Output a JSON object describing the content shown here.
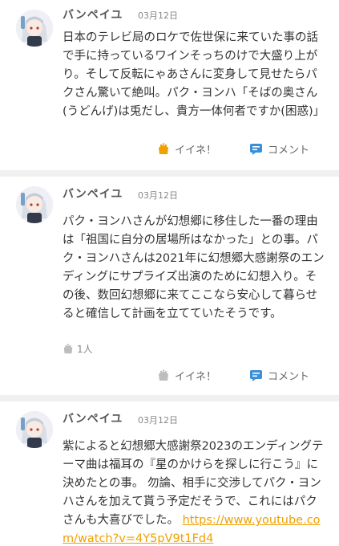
{
  "posts": [
    {
      "user": "バンペイユ",
      "date": "03月12日",
      "text": "日本のテレビ局のロケで佐世保に来ていた事の話で手に持っているワインそっちのけで大盛り上がり。そして反転にゃあさんに変身して見せたらパクさん驚いて絶叫。パク・ヨンハ「そばの奥さん(うどんげ)は兎だし、貴方一体何者ですか(困惑)」",
      "like_label": "イイネ！",
      "comment_label": "コメント",
      "liked": true
    },
    {
      "user": "バンペイユ",
      "date": "03月12日",
      "text": "パク・ヨンハさんが幻想郷に移住した一番の理由は「祖国に自分の居場所はなかった」との事。パク・ヨンハさんは2021年に幻想郷大感謝祭のエンディングにサプライズ出演のために幻想入り。その後、数回幻想郷に来てここなら安心して暮らせると確信して計画を立てていたそうです。",
      "likes_count": "1人",
      "like_label": "イイネ！",
      "comment_label": "コメント",
      "liked": false
    },
    {
      "user": "バンペイユ",
      "date": "03月12日",
      "text": "紫によると幻想郷大感謝祭2023のエンディングテーマ曲は福耳の『星のかけらを探しに行こう』に決めたとの事。 勿論、相手に交渉してパク・ヨンハさんを加えて貰う予定だそうで、これにはパクさんも大喜びでした。",
      "link": "https://www.youtube.com/watch?v=4Y5pV9t1Fd4"
    }
  ],
  "colors": {
    "accent": "#f0a000",
    "comment_icon": "#3a8fd6",
    "like_inactive": "#bdbdbd"
  }
}
